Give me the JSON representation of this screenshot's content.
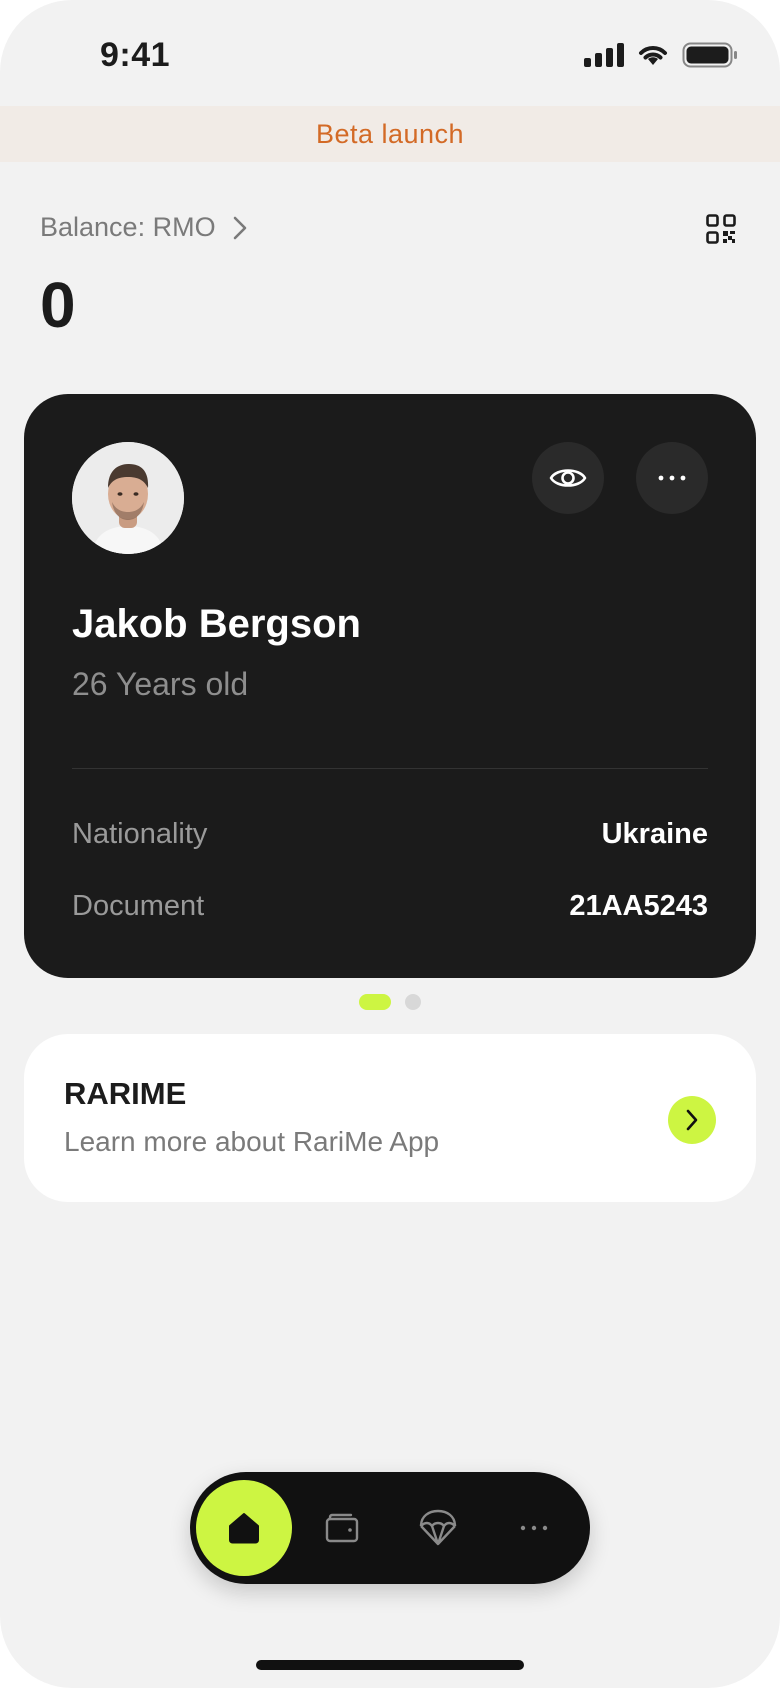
{
  "status_bar": {
    "time": "9:41"
  },
  "banner": {
    "text": "Beta launch"
  },
  "balance": {
    "label": "Balance: RMO",
    "value": "0"
  },
  "identity_card": {
    "name": "Jakob Bergson",
    "age": "26 Years old",
    "fields": [
      {
        "label": "Nationality",
        "value": "Ukraine"
      },
      {
        "label": "Document",
        "value": "21AA5243"
      }
    ]
  },
  "pager": {
    "active": 0,
    "count": 2
  },
  "info_card": {
    "title": "RARIME",
    "subtitle": "Learn more about RariMe App"
  },
  "nav": {
    "items": [
      {
        "name": "home",
        "icon": "home-icon",
        "active": true
      },
      {
        "name": "wallet",
        "icon": "wallet-icon",
        "active": false
      },
      {
        "name": "rewards",
        "icon": "parachute-icon",
        "active": false
      },
      {
        "name": "more",
        "icon": "more-icon",
        "active": false
      }
    ]
  },
  "colors": {
    "accent": "#cdf542",
    "banner_text": "#d36a26",
    "card_bg": "#1b1b1b"
  }
}
